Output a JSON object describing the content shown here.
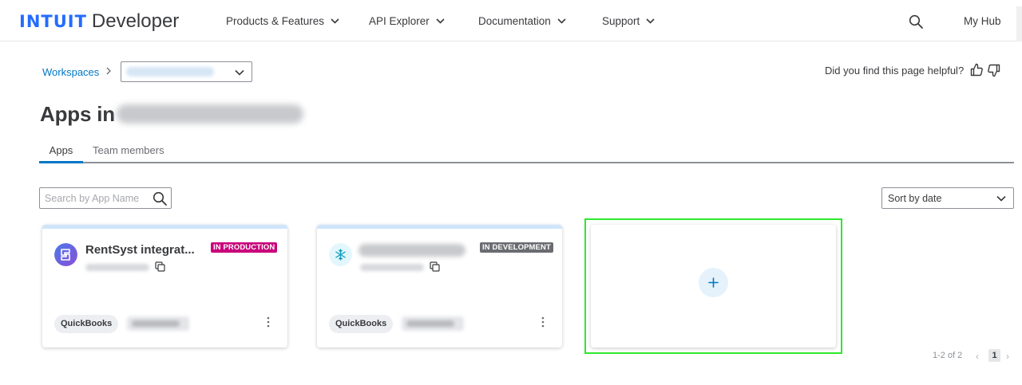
{
  "header": {
    "logo_brand": "INTUIT",
    "logo_product": "Developer",
    "nav": [
      {
        "label": "Products & Features"
      },
      {
        "label": "API Explorer"
      },
      {
        "label": "Documentation"
      },
      {
        "label": "Support"
      }
    ],
    "search_icon": "search-icon",
    "myhub_label": "My Hub"
  },
  "breadcrumb": {
    "workspaces_label": "Workspaces"
  },
  "feedback": {
    "question": "Did you find this page helpful?"
  },
  "page": {
    "title_prefix": "Apps in"
  },
  "tabs": [
    {
      "label": "Apps",
      "active": true
    },
    {
      "label": "Team members",
      "active": false
    }
  ],
  "search": {
    "placeholder": "Search by App Name"
  },
  "sort": {
    "selected": "Sort by date"
  },
  "apps": [
    {
      "name": "RentSyst integrat...",
      "status": "IN PRODUCTION",
      "status_color": "#c9007a",
      "product": "QuickBooks",
      "icon": "rentsyst-logo-icon"
    },
    {
      "status": "IN DEVELOPMENT",
      "status_color": "#6b6c72",
      "product": "QuickBooks",
      "icon": "snowflake-icon"
    }
  ],
  "add_card": {
    "icon": "plus-icon"
  },
  "pagination": {
    "summary": "1-2 of 2",
    "current": "1",
    "prev": "‹",
    "next": "›"
  },
  "colors": {
    "accent": "#0077c5",
    "brand_blue": "#236cff",
    "highlight": "#2ee82e"
  }
}
